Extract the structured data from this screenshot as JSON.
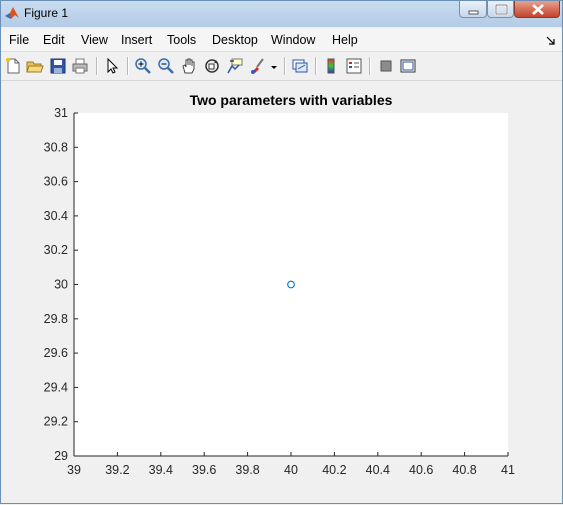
{
  "window": {
    "title": "Figure 1"
  },
  "menubar": {
    "items": [
      {
        "label": "File"
      },
      {
        "label": "Edit"
      },
      {
        "label": "View"
      },
      {
        "label": "Insert"
      },
      {
        "label": "Tools"
      },
      {
        "label": "Desktop"
      },
      {
        "label": "Window"
      },
      {
        "label": "Help"
      }
    ]
  },
  "toolbar": {
    "icons": [
      "new-figure-icon",
      "open-file-icon",
      "save-icon",
      "print-icon",
      "select-arrow-icon",
      "zoom-in-icon",
      "zoom-out-icon",
      "pan-hand-icon",
      "rotate-3d-icon",
      "data-cursor-icon",
      "brush-icon",
      "link-plot-icon",
      "colorbar-icon",
      "legend-icon",
      "hide-plot-tools-icon",
      "show-plot-tools-icon"
    ]
  },
  "colors": {
    "marker": "#0072bd",
    "axes_bg": "#ffffff",
    "figure_bg": "#f0f0f0"
  },
  "chart_data": {
    "type": "scatter",
    "title": "Two parameters with variables",
    "xlabel": "",
    "ylabel": "",
    "xlim": [
      39,
      41
    ],
    "ylim": [
      29,
      31
    ],
    "xticks": [
      39,
      39.2,
      39.4,
      39.6,
      39.8,
      40,
      40.2,
      40.4,
      40.6,
      40.8,
      41
    ],
    "xtick_labels": [
      "39",
      "39.2",
      "39.4",
      "39.6",
      "39.8",
      "40",
      "40.2",
      "40.4",
      "40.6",
      "40.8",
      "41"
    ],
    "yticks": [
      29,
      29.2,
      29.4,
      29.6,
      29.8,
      30,
      30.2,
      30.4,
      30.6,
      30.8,
      31
    ],
    "ytick_labels": [
      "29",
      "29.2",
      "29.4",
      "29.6",
      "29.8",
      "30",
      "30.2",
      "30.4",
      "30.6",
      "30.8",
      "31"
    ],
    "grid": false,
    "marker": "open-circle",
    "series": [
      {
        "x": [
          40
        ],
        "y": [
          30
        ]
      }
    ]
  }
}
